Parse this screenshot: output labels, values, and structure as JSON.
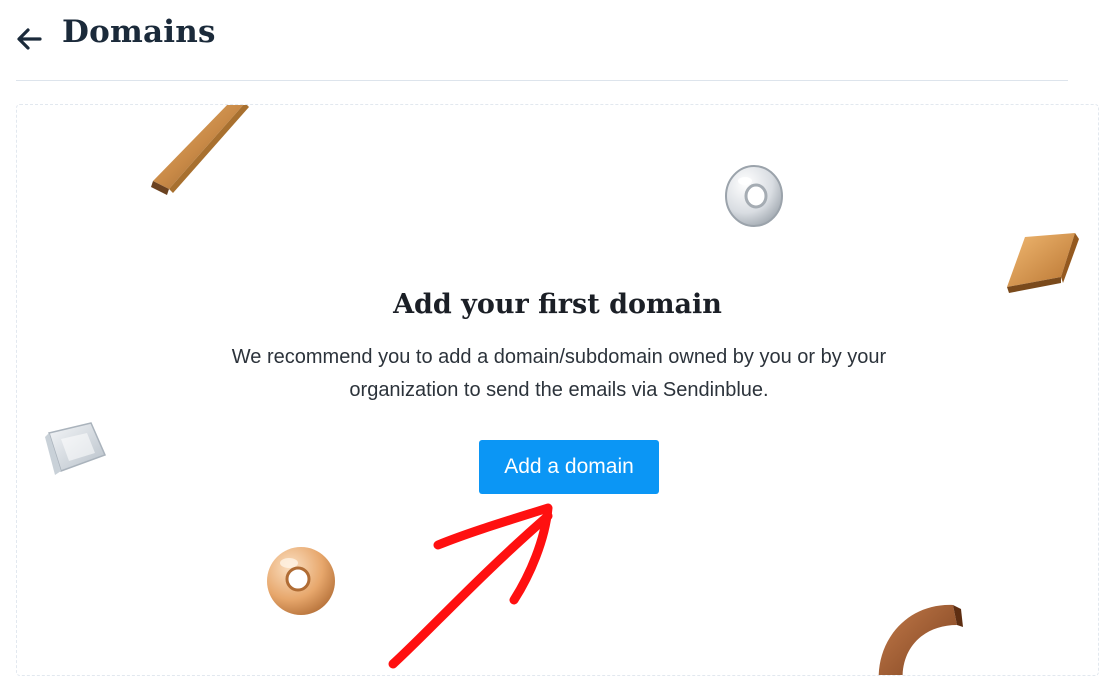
{
  "header": {
    "title": "Domains",
    "back_icon": "arrow-left-icon"
  },
  "empty_state": {
    "title": "Add your first domain",
    "description": "We recommend you to add a domain/subdomain owned by you or by your organization to send the emails via Sendinblue.",
    "button_label": "Add a domain"
  },
  "colors": {
    "primary_button": "#0b96f5",
    "title_text": "#1b2a3a",
    "annotation_arrow": "#ff1010"
  },
  "decorations": [
    "wooden-plank-icon",
    "glass-ring-icon",
    "wooden-tile-icon",
    "glass-cube-icon",
    "copper-ring-icon",
    "wooden-arc-icon"
  ],
  "annotation": "red-arrow-icon"
}
